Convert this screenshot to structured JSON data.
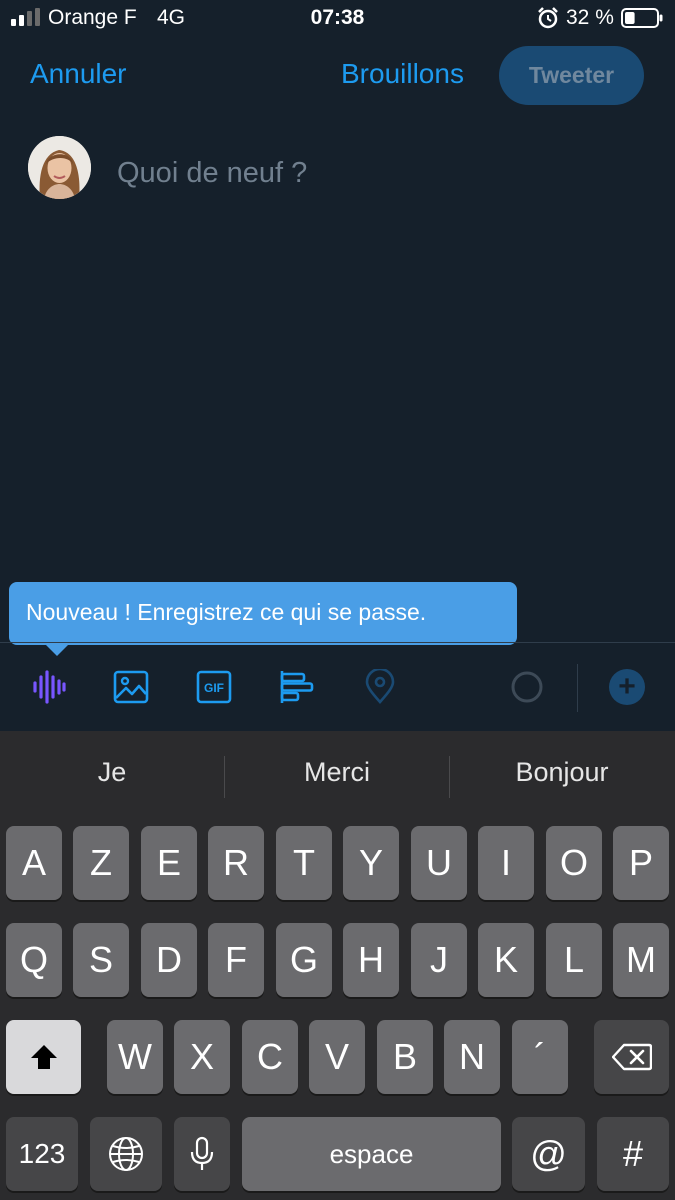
{
  "status_bar": {
    "carrier": "Orange F",
    "network": "4G",
    "time": "07:38",
    "battery_percent": "32 %",
    "battery_level": 0.32
  },
  "nav": {
    "cancel_label": "Annuler",
    "drafts_label": "Brouillons",
    "tweet_label": "Tweeter"
  },
  "compose": {
    "placeholder": "Quoi de neuf ?"
  },
  "tooltip": {
    "text": "Nouveau ! Enregistrez ce qui se passe."
  },
  "toolbar": {
    "icons": [
      "voice-record-icon",
      "image-icon",
      "gif-icon",
      "poll-icon",
      "location-icon",
      "character-count-icon",
      "add-tweet-icon"
    ],
    "add_label": "+",
    "accent_color": "#1d9bf0",
    "voice_color": "#7856ff"
  },
  "keyboard": {
    "suggestions": [
      "Je",
      "Merci",
      "Bonjour"
    ],
    "row1": [
      "A",
      "Z",
      "E",
      "R",
      "T",
      "Y",
      "U",
      "I",
      "O",
      "P"
    ],
    "row2": [
      "Q",
      "S",
      "D",
      "F",
      "G",
      "H",
      "J",
      "K",
      "L",
      "M"
    ],
    "row3": [
      "W",
      "X",
      "C",
      "V",
      "B",
      "N",
      "´"
    ],
    "numbers_label": "123",
    "space_label": "espace",
    "at_label": "@",
    "hash_label": "#"
  }
}
